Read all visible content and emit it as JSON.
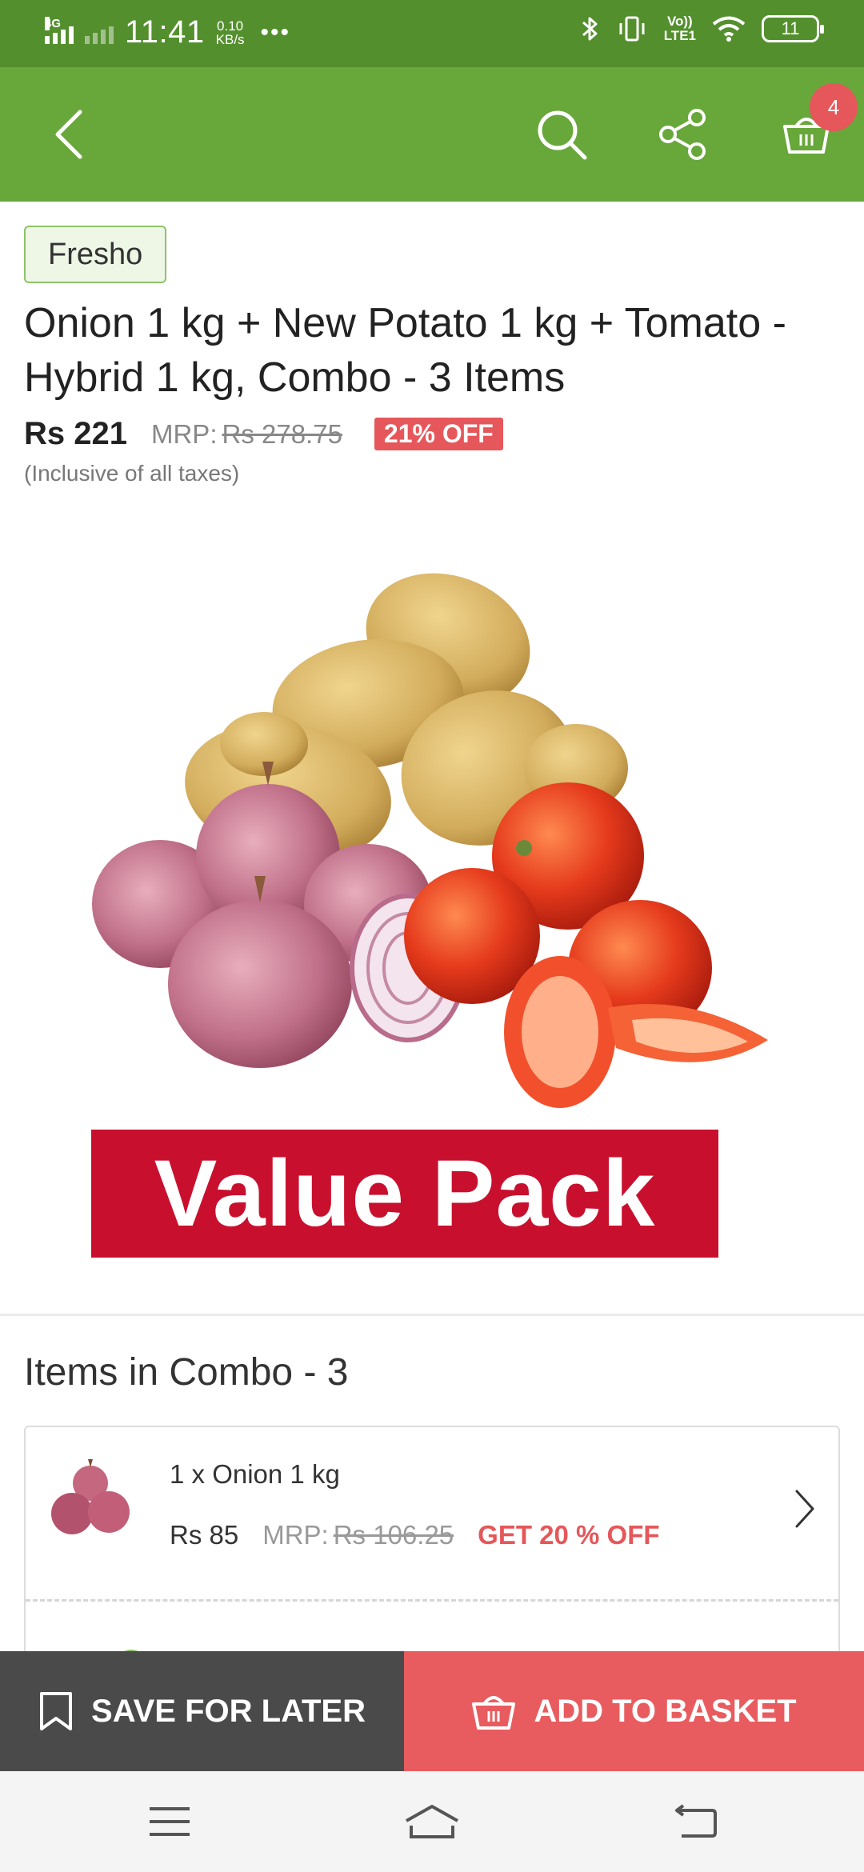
{
  "status_bar": {
    "network": "4G",
    "time": "11:41",
    "speed_value": "0.10",
    "speed_unit": "KB/s",
    "more": "•••",
    "lte_top": "Vo))",
    "lte_bottom": "LTE1",
    "battery": "11"
  },
  "app_bar": {
    "cart_count": "4"
  },
  "product": {
    "brand": "Fresho",
    "title": "Onion 1 kg + New Potato 1 kg + Tomato - Hybrid 1 kg, Combo - 3 Items",
    "price": "Rs 221",
    "mrp_label": "MRP:",
    "mrp_value": "Rs 278.75",
    "discount": "21% OFF",
    "tax_note": "(Inclusive of all taxes)",
    "image_banner": "Value Pack"
  },
  "combo": {
    "heading": "Items in Combo - 3",
    "items": [
      {
        "name": "1 x Onion 1 kg",
        "price": "Rs 85",
        "mrp_label": "MRP:",
        "mrp_value": "Rs 106.25",
        "offer": "GET 20 % OFF"
      }
    ]
  },
  "actions": {
    "save_label": "SAVE FOR LATER",
    "add_label": "ADD TO BASKET"
  },
  "colors": {
    "status_bar": "#548f2e",
    "app_bar": "#68a73a",
    "accent_red": "#e5575a",
    "value_pack_red": "#c8102e",
    "save_button": "#4a4a4a"
  },
  "icons": {
    "back": "back-arrow-icon",
    "search": "search-icon",
    "share": "share-icon",
    "cart": "basket-icon",
    "bookmark": "bookmark-icon",
    "chevron": "chevron-right-icon"
  }
}
